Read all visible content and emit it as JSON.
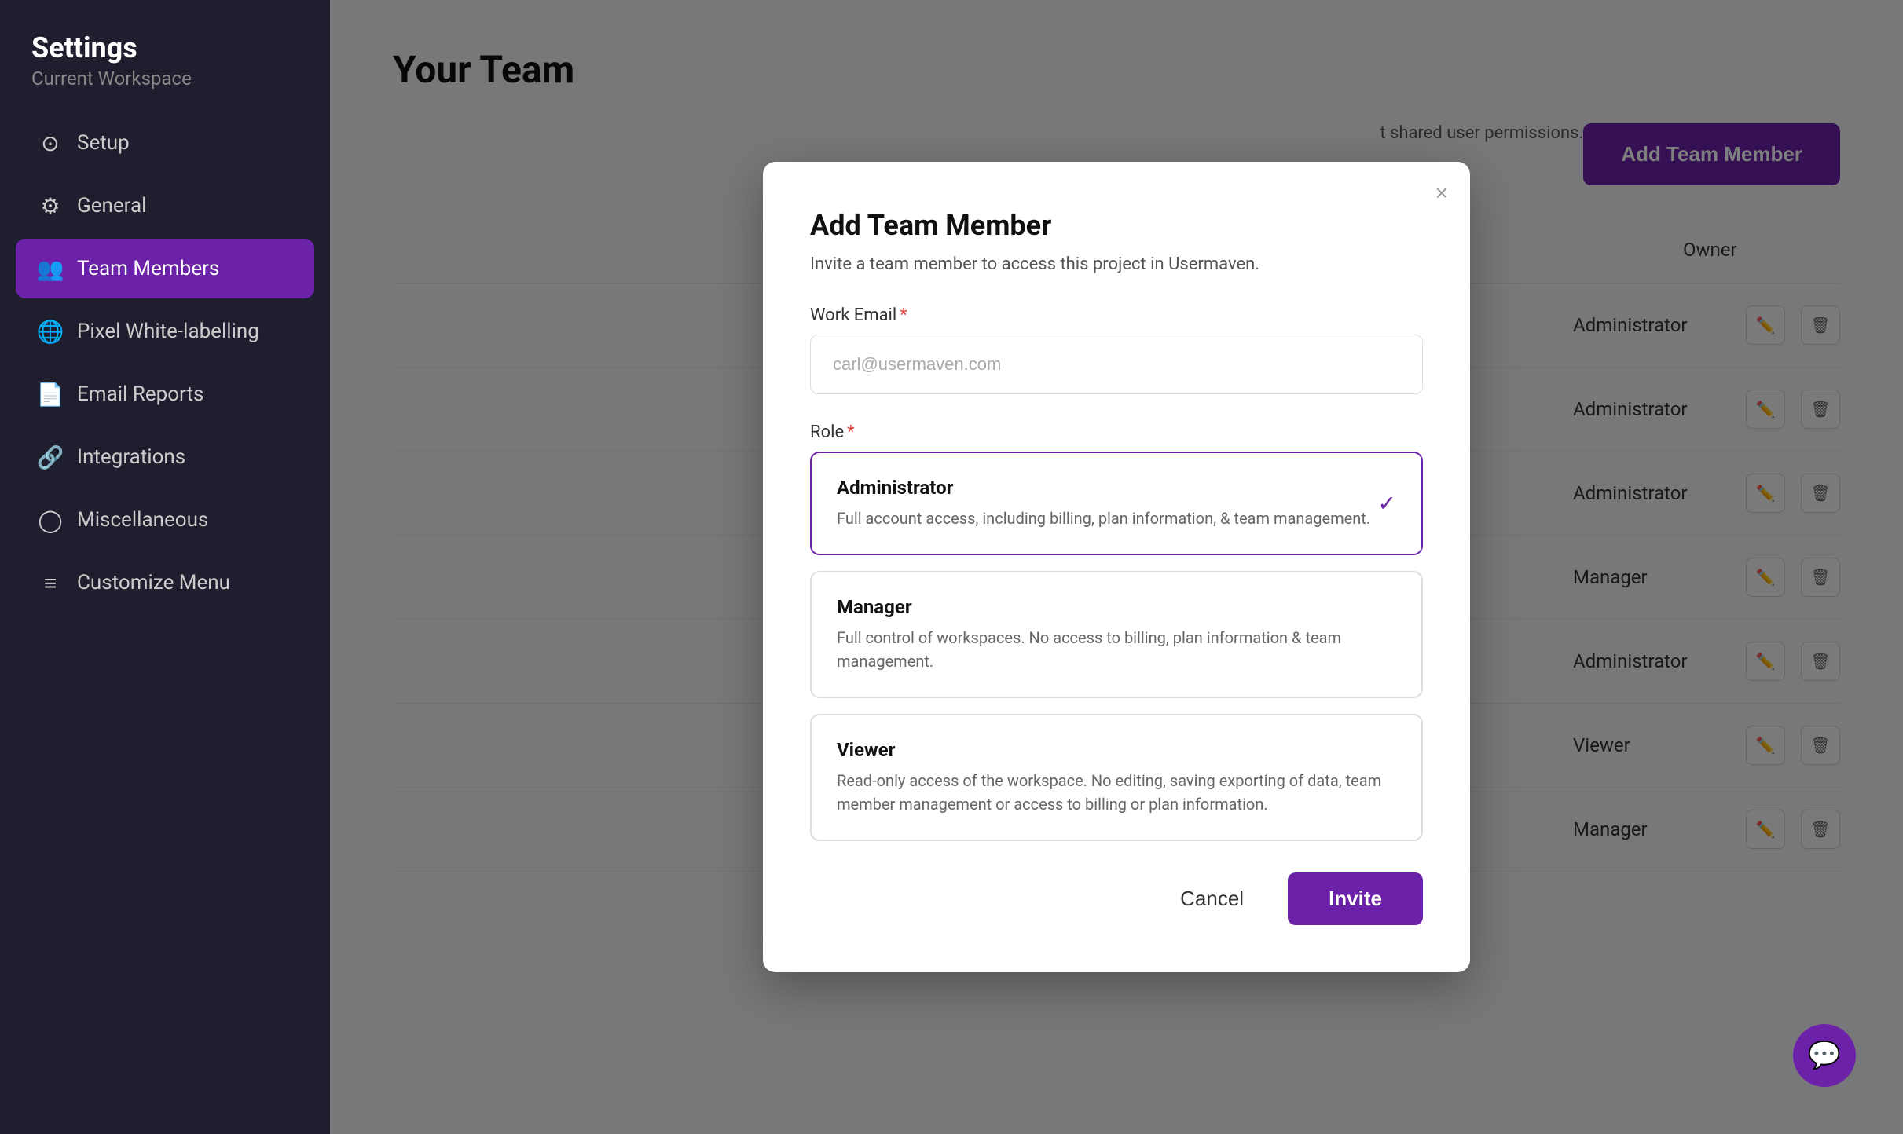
{
  "sidebar": {
    "title": "Settings",
    "subtitle": "Current Workspace",
    "items": [
      {
        "id": "setup",
        "label": "Setup",
        "icon": "⊙"
      },
      {
        "id": "general",
        "label": "General",
        "icon": "⚙"
      },
      {
        "id": "team-members",
        "label": "Team Members",
        "icon": "👥",
        "active": true
      },
      {
        "id": "pixel-whitelabelling",
        "label": "Pixel White-labelling",
        "icon": "🌐"
      },
      {
        "id": "email-reports",
        "label": "Email Reports",
        "icon": "📄"
      },
      {
        "id": "integrations",
        "label": "Integrations",
        "icon": "🔗"
      },
      {
        "id": "miscellaneous",
        "label": "Miscellaneous",
        "icon": "◯"
      },
      {
        "id": "customize-menu",
        "label": "Customize Menu",
        "icon": "≡"
      }
    ]
  },
  "main": {
    "page_title": "Your Team",
    "description": "t shared user permissions.",
    "add_member_button": "Add Team Member",
    "team_rows": [
      {
        "role": "Owner"
      },
      {
        "role": "Administrator"
      },
      {
        "role": "Administrator"
      },
      {
        "role": "Administrator"
      },
      {
        "role": "Manager"
      },
      {
        "role": "Administrator"
      },
      {
        "role": "Viewer"
      },
      {
        "role": "Manager"
      }
    ]
  },
  "dialog": {
    "title": "Add Team Member",
    "subtitle": "Invite a team member to access this project in Usermaven.",
    "close_label": "×",
    "work_email_label": "Work Email",
    "work_email_required": "*",
    "work_email_placeholder": "carl@usermaven.com",
    "role_label": "Role",
    "role_required": "*",
    "roles": [
      {
        "id": "administrator",
        "title": "Administrator",
        "description": "Full account access, including billing, plan information, & team management.",
        "selected": true
      },
      {
        "id": "manager",
        "title": "Manager",
        "description": "Full control of workspaces. No access to billing, plan information & team management.",
        "selected": false
      },
      {
        "id": "viewer",
        "title": "Viewer",
        "description": "Read-only access of the workspace. No editing, saving exporting of data, team member management or access to billing or plan information.",
        "selected": false
      }
    ],
    "cancel_button": "Cancel",
    "invite_button": "Invite"
  }
}
